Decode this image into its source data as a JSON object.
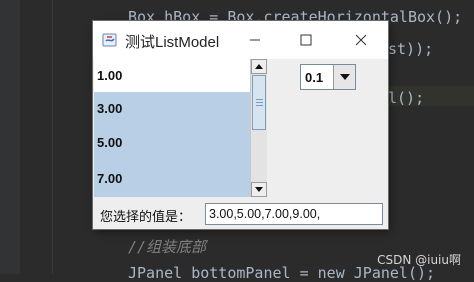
{
  "editor": {
    "lines": [
      "Box hBox = Box.createHorizontalBox();",
      "st));",
      "l();",
      "//组装底部",
      "JPanel bottomPanel = new JPanel();"
    ]
  },
  "window": {
    "title": "测试ListModel",
    "controls": {
      "minimize": "—",
      "maximize": "☐",
      "close": "✕"
    }
  },
  "list": {
    "items": [
      {
        "label": "1.00",
        "selected": false
      },
      {
        "label": "3.00",
        "selected": true
      },
      {
        "label": "5.00",
        "selected": true
      },
      {
        "label": "7.00",
        "selected": true
      }
    ]
  },
  "combo": {
    "value": "0.1"
  },
  "selection": {
    "label": "您选择的值是：",
    "value": "3.00,5.00,7.00,9.00,"
  },
  "watermark": "CSDN @iuiu啊",
  "colors": {
    "selection_bg": "#b8cfe5",
    "editor_bg": "#2b2b2b"
  }
}
